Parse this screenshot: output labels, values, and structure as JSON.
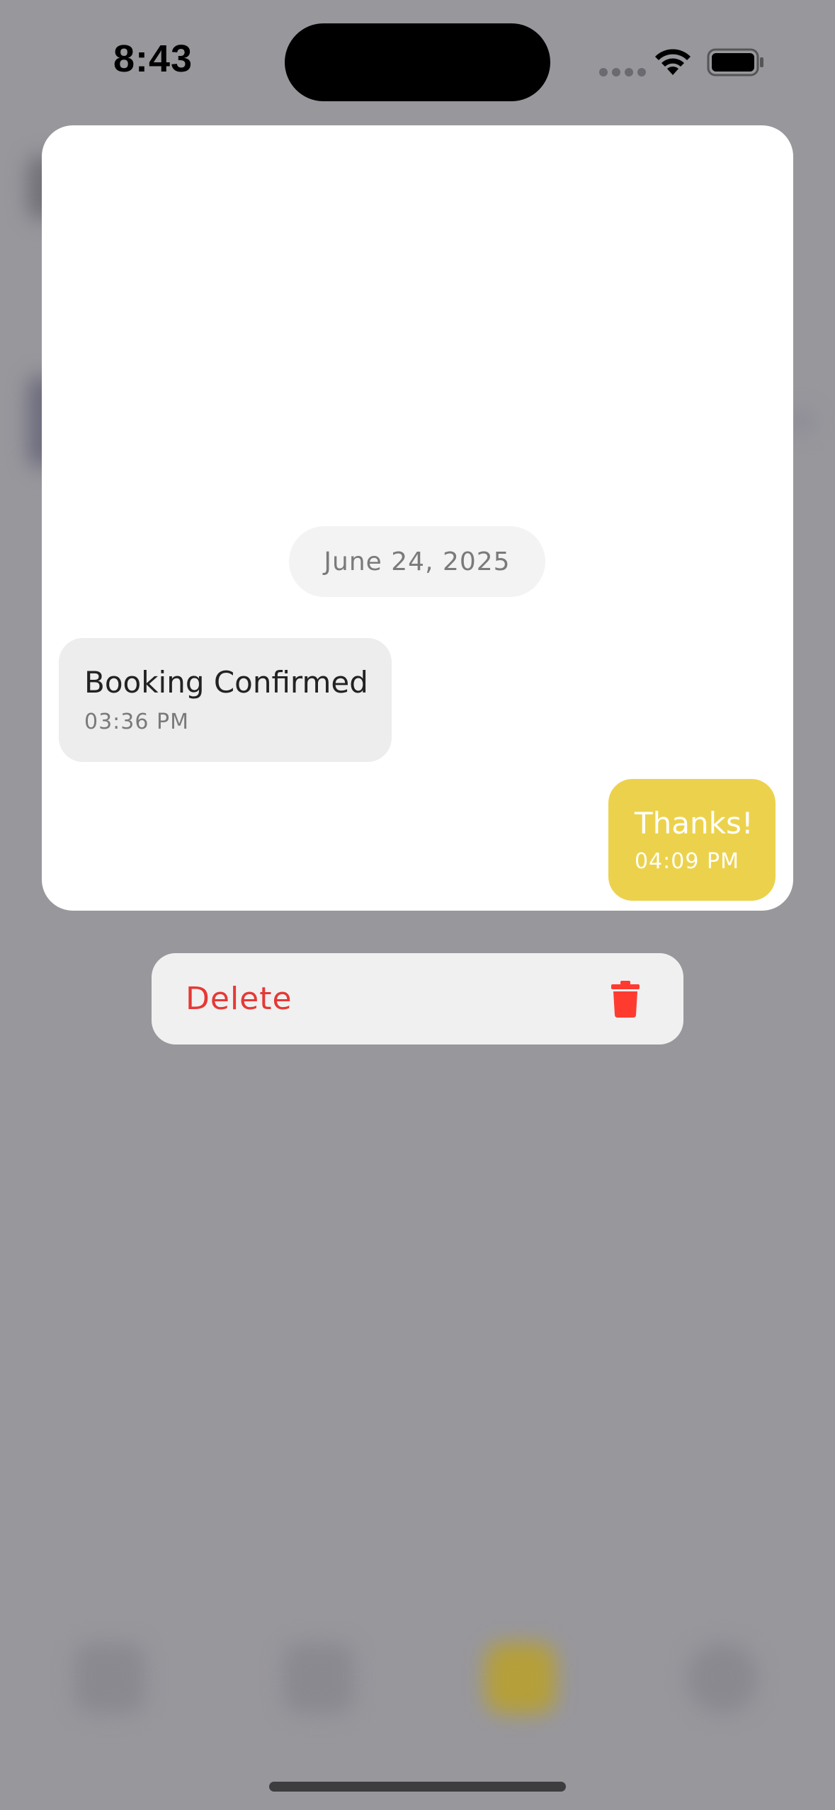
{
  "status_bar": {
    "time": "8:43",
    "icons": [
      "signal-dots-icon",
      "wifi-icon",
      "battery-icon"
    ]
  },
  "preview": {
    "date_label": "June 24, 2025",
    "messages": [
      {
        "direction": "incoming",
        "text": "Booking Confirmed",
        "time": "03:36 PM"
      },
      {
        "direction": "outgoing",
        "text": "Thanks!",
        "time": "04:09 PM"
      }
    ]
  },
  "context_menu": {
    "delete_label": "Delete",
    "delete_icon": "trash-icon"
  },
  "background_tabs": [
    "search-icon",
    "phone-icon",
    "chat-icon",
    "profile-icon"
  ],
  "colors": {
    "overlay": "#98979c",
    "card": "#ffffff",
    "incoming_bubble": "#ededed",
    "outgoing_bubble": "#ecd24c",
    "destructive": "#e53935",
    "trash": "#ff3b30"
  }
}
